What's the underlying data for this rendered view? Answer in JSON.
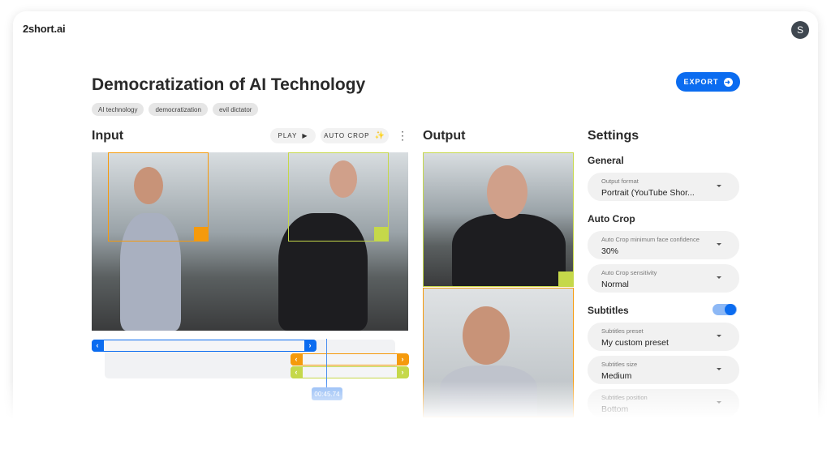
{
  "app": {
    "logo": "2short.ai",
    "avatar_initial": "S"
  },
  "project": {
    "title": "Democratization of AI Technology",
    "tags": [
      "AI technology",
      "democratization",
      "evil dictator"
    ],
    "export_label": "EXPORT"
  },
  "input": {
    "heading": "Input",
    "play_label": "PLAY",
    "auto_crop_label": "AUTO CROP",
    "more_icon": "more-vertical-icon"
  },
  "output": {
    "heading": "Output"
  },
  "timeline": {
    "playhead_time": "00:45.74"
  },
  "settings": {
    "heading": "Settings",
    "general": {
      "heading": "General",
      "output_format": {
        "label": "Output format",
        "value": "Portrait (YouTube Shor..."
      }
    },
    "auto_crop": {
      "heading": "Auto Crop",
      "confidence": {
        "label": "Auto Crop minimum face confidence",
        "value": "30%"
      },
      "sensitivity": {
        "label": "Auto Crop sensitivity",
        "value": "Normal"
      }
    },
    "subtitles": {
      "heading": "Subtitles",
      "enabled": true,
      "preset": {
        "label": "Subtitles preset",
        "value": "My custom preset"
      },
      "size": {
        "label": "Subtitles size",
        "value": "Medium"
      },
      "position": {
        "label": "Subtitles position",
        "value": "Bottom"
      }
    }
  },
  "colors": {
    "accent": "#0b6cf0",
    "crop_orange": "#f59a0c",
    "crop_green": "#c5d84a"
  }
}
